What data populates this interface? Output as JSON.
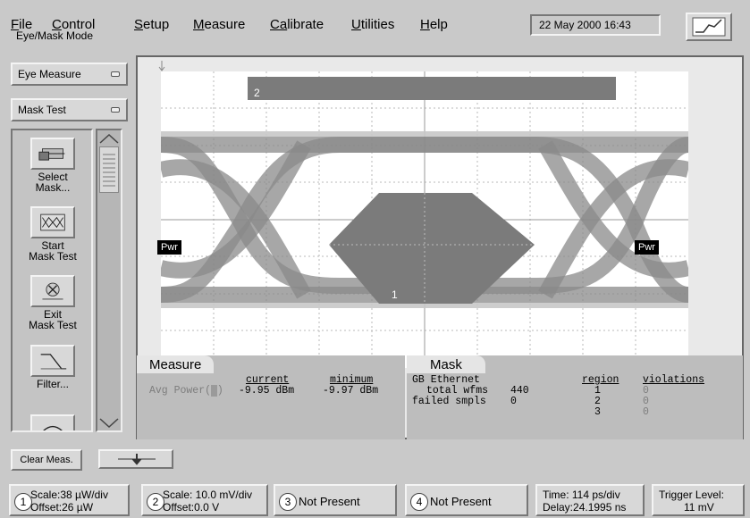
{
  "menu": {
    "items": [
      {
        "key": "F",
        "rest": "ile"
      },
      {
        "key": "C",
        "rest": "ontrol"
      },
      {
        "key": "S",
        "rest": "etup"
      },
      {
        "key": "M",
        "rest": "easure"
      },
      {
        "key": "Ca",
        "rest": "librate"
      },
      {
        "key": "U",
        "rest": "tilities"
      },
      {
        "key": "H",
        "rest": "elp"
      }
    ],
    "datetime": "22 May 2000   16:43"
  },
  "left_panel": {
    "mode_label": "Eye/Mask Mode",
    "measure_select": "Eye Measure",
    "test_select": "Mask Test",
    "softkeys": [
      {
        "label1": "Select",
        "label2": "Mask...",
        "icon": "select-mask-icon"
      },
      {
        "label1": "Start",
        "label2": "Mask Test",
        "icon": "start-mask-test-icon"
      },
      {
        "label1": "Exit",
        "label2": "Mask Test",
        "icon": "exit-mask-test-icon"
      },
      {
        "label1": "Filter...",
        "label2": "",
        "icon": "filter-icon"
      }
    ]
  },
  "display": {
    "mask_region_top": "2",
    "mask_region_center": "1",
    "pwr_left": "Pwr",
    "pwr_right": "Pwr"
  },
  "measure_panel": {
    "tab": "Measure",
    "header_current": "current",
    "header_minimum": "minimum",
    "row_label": "Avg Power(",
    "row_channel": "1",
    "row_close": ")",
    "current": "-9.95 dBm",
    "minimum": "-9.97 dBm"
  },
  "mask_panel": {
    "tab": "Mask",
    "standard": "GB Ethernet",
    "total_label": "total wfms",
    "total_value": "440",
    "failed_label": "failed smpls",
    "failed_value": "0",
    "region_header": "region",
    "violations_header": "violations",
    "rows": [
      {
        "region": "1",
        "violations": "0"
      },
      {
        "region": "2",
        "violations": "0"
      },
      {
        "region": "3",
        "violations": "0"
      }
    ]
  },
  "bottom": {
    "clear_meas": "Clear Meas.",
    "status": [
      {
        "num": "1",
        "line1": "Scale:38 µW/div",
        "line2": "Offset:26 µW"
      },
      {
        "num": "2",
        "line1": "Scale: 10.0 mV/div",
        "line2": "Offset:0.0 V"
      },
      {
        "num": "3",
        "line1": "Not Present",
        "line2": ""
      },
      {
        "num": "4",
        "line1": "Not Present",
        "line2": ""
      }
    ],
    "time_line1": "Time:  114 ps/div",
    "time_line2": "Delay:24.1995 ns",
    "trigger_line1": "Trigger Level:",
    "trigger_line2": "11 mV"
  }
}
